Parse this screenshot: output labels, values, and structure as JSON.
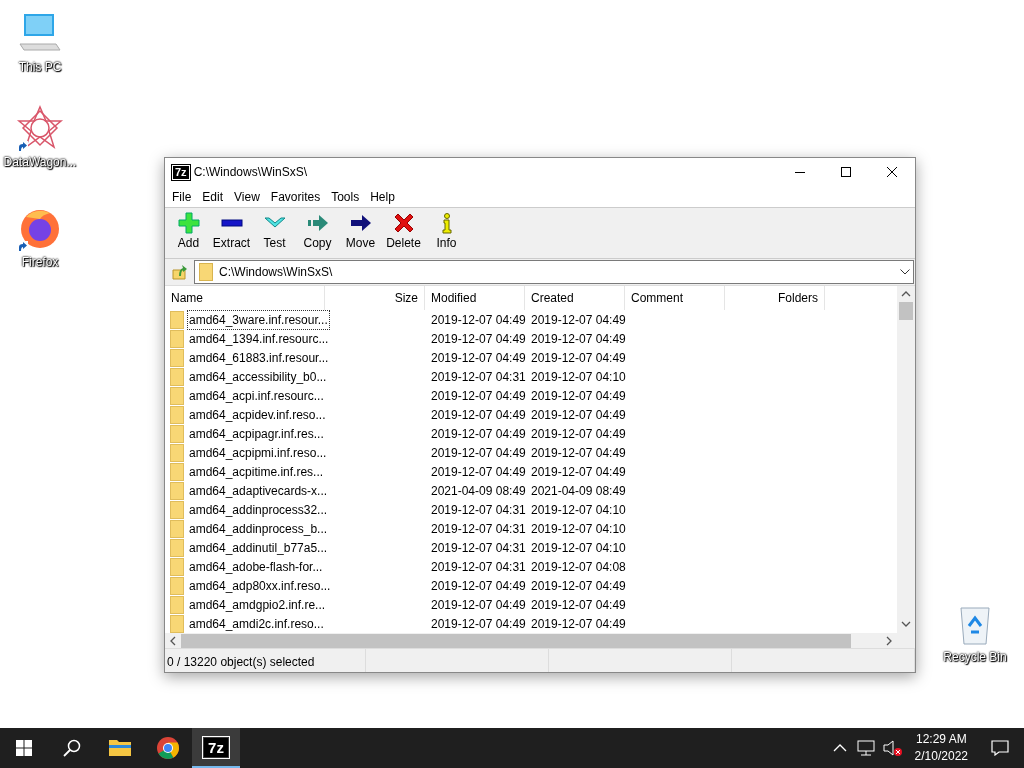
{
  "desktop_icons": [
    {
      "label": "This PC",
      "kind": "pc",
      "shortcut": false
    },
    {
      "label": "DataWagon...",
      "kind": "star",
      "shortcut": true
    },
    {
      "label": "Firefox",
      "kind": "firefox",
      "shortcut": true
    },
    {
      "label": "Recycle Bin",
      "kind": "bin",
      "shortcut": false
    }
  ],
  "window": {
    "app_logo": "7z",
    "title": "C:\\Windows\\WinSxS\\"
  },
  "menu": [
    "File",
    "Edit",
    "View",
    "Favorites",
    "Tools",
    "Help"
  ],
  "toolbar": [
    {
      "label": "Add",
      "kind": "add"
    },
    {
      "label": "Extract",
      "kind": "extract"
    },
    {
      "label": "Test",
      "kind": "test"
    },
    {
      "label": "Copy",
      "kind": "copy"
    },
    {
      "label": "Move",
      "kind": "move"
    },
    {
      "label": "Delete",
      "kind": "delete"
    },
    {
      "label": "Info",
      "kind": "info"
    }
  ],
  "address": {
    "value": "C:\\Windows\\WinSxS\\"
  },
  "table": {
    "columns": [
      "Name",
      "Size",
      "Modified",
      "Created",
      "Comment",
      "Folders"
    ],
    "rows": [
      {
        "name": "amd64_3ware.inf.resour...",
        "modified": "2019-12-07 04:49",
        "created": "2019-12-07 04:49",
        "focused": true
      },
      {
        "name": "amd64_1394.inf.resourc...",
        "modified": "2019-12-07 04:49",
        "created": "2019-12-07 04:49",
        "focused": false
      },
      {
        "name": "amd64_61883.inf.resour...",
        "modified": "2019-12-07 04:49",
        "created": "2019-12-07 04:49",
        "focused": false
      },
      {
        "name": "amd64_accessibility_b0...",
        "modified": "2019-12-07 04:31",
        "created": "2019-12-07 04:10",
        "focused": false
      },
      {
        "name": "amd64_acpi.inf.resourc...",
        "modified": "2019-12-07 04:49",
        "created": "2019-12-07 04:49",
        "focused": false
      },
      {
        "name": "amd64_acpidev.inf.reso...",
        "modified": "2019-12-07 04:49",
        "created": "2019-12-07 04:49",
        "focused": false
      },
      {
        "name": "amd64_acpipagr.inf.res...",
        "modified": "2019-12-07 04:49",
        "created": "2019-12-07 04:49",
        "focused": false
      },
      {
        "name": "amd64_acpipmi.inf.reso...",
        "modified": "2019-12-07 04:49",
        "created": "2019-12-07 04:49",
        "focused": false
      },
      {
        "name": "amd64_acpitime.inf.res...",
        "modified": "2019-12-07 04:49",
        "created": "2019-12-07 04:49",
        "focused": false
      },
      {
        "name": "amd64_adaptivecards-x...",
        "modified": "2021-04-09 08:49",
        "created": "2021-04-09 08:49",
        "focused": false
      },
      {
        "name": "amd64_addinprocess32...",
        "modified": "2019-12-07 04:31",
        "created": "2019-12-07 04:10",
        "focused": false
      },
      {
        "name": "amd64_addinprocess_b...",
        "modified": "2019-12-07 04:31",
        "created": "2019-12-07 04:10",
        "focused": false
      },
      {
        "name": "amd64_addinutil_b77a5...",
        "modified": "2019-12-07 04:31",
        "created": "2019-12-07 04:10",
        "focused": false
      },
      {
        "name": "amd64_adobe-flash-for...",
        "modified": "2019-12-07 04:31",
        "created": "2019-12-07 04:08",
        "focused": false
      },
      {
        "name": "amd64_adp80xx.inf.reso...",
        "modified": "2019-12-07 04:49",
        "created": "2019-12-07 04:49",
        "focused": false
      },
      {
        "name": "amd64_amdgpio2.inf.re...",
        "modified": "2019-12-07 04:49",
        "created": "2019-12-07 04:49",
        "focused": false
      },
      {
        "name": "amd64_amdi2c.inf.reso...",
        "modified": "2019-12-07 04:49",
        "created": "2019-12-07 04:49",
        "focused": false
      }
    ]
  },
  "status_bar": {
    "text": "0 / 13220 object(s) selected"
  },
  "taskbar": {
    "apps": [
      {
        "kind": "explorer",
        "active": false
      },
      {
        "kind": "chrome",
        "active": false
      },
      {
        "kind": "archiver",
        "label": "7z",
        "active": true
      }
    ],
    "time": "12:29 AM",
    "date": "2/10/2022"
  }
}
